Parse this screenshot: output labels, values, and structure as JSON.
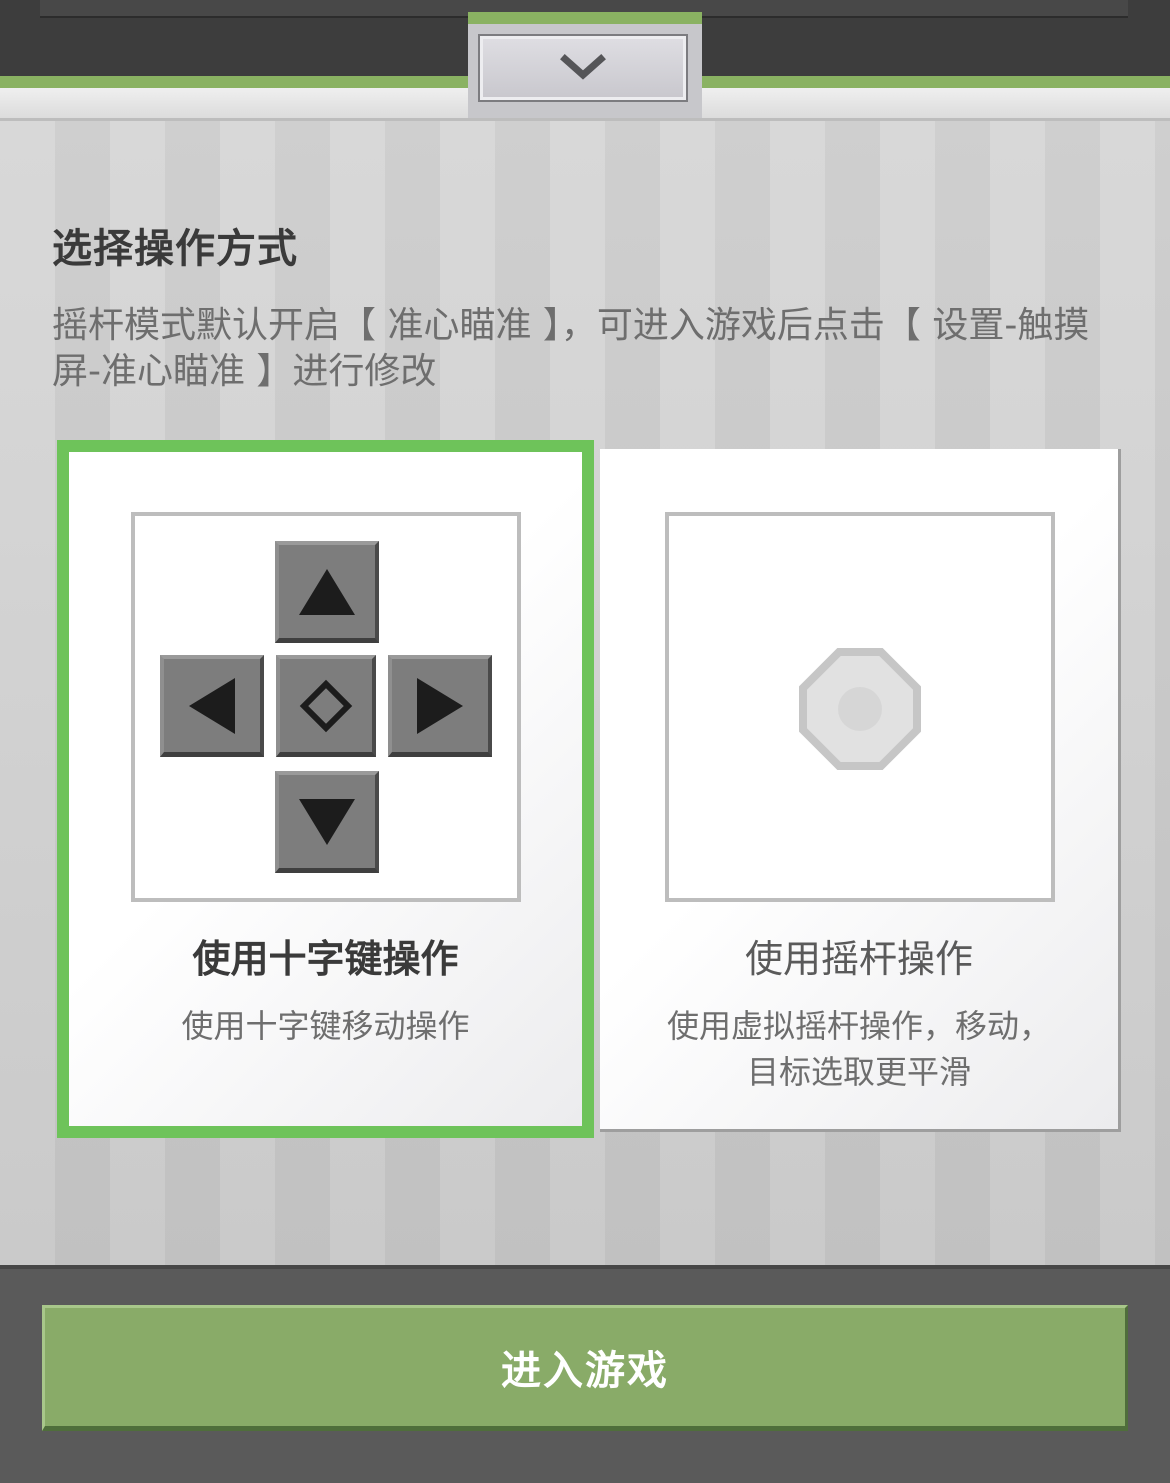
{
  "header": {
    "collapse_icon": "chevron-down-icon"
  },
  "main": {
    "title": "选择操作方式",
    "description": "摇杆模式默认开启【 准心瞄准 】，可进入游戏后点击【 设置-触摸屏-准心瞄准 】进行修改"
  },
  "options": [
    {
      "title": "使用十字键操作",
      "description": "使用十字键移动操作",
      "selected": true,
      "icon": "dpad-icon"
    },
    {
      "title": "使用摇杆操作",
      "description_line1": "使用虚拟摇杆操作，移动，",
      "description_line2": "目标选取更平滑",
      "selected": false,
      "icon": "joystick-icon"
    }
  ],
  "footer": {
    "enter_label": "进入游戏"
  },
  "colors": {
    "accent_green": "#6ec35a",
    "button_green": "#89ab68",
    "header_dark": "#3d3d3d"
  }
}
